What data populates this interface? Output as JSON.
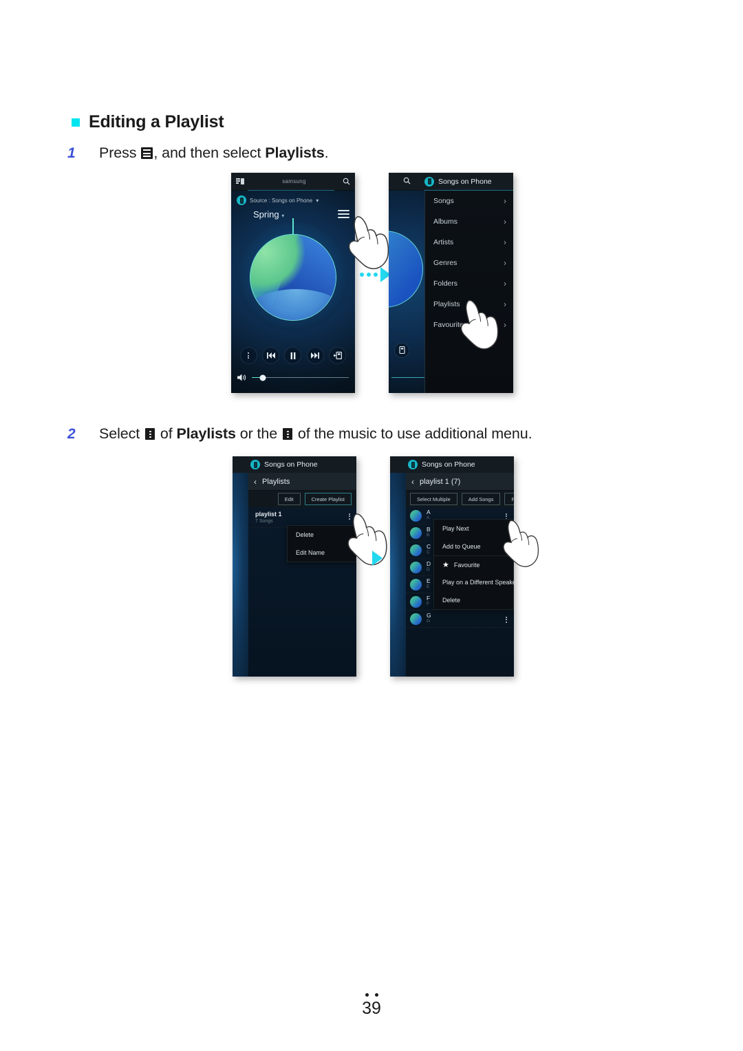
{
  "heading": {
    "bullet_color": "#00e5f0",
    "title": "Editing a Playlist"
  },
  "steps": [
    {
      "num": "1",
      "prefix": "Press ",
      "mid": ", and then select ",
      "bold": "Playlists",
      "suffix": "."
    },
    {
      "num": "2",
      "prefix": "Select ",
      "mid": " of ",
      "bold": "Playlists",
      "mid2": " or the ",
      "suffix": " of the music to use additional menu."
    }
  ],
  "phone1": {
    "topbar": {
      "cast_icon": "cast-icon",
      "title": "samsung",
      "search_icon": "search-icon"
    },
    "source_label": "Source : Songs on Phone",
    "source_caret": "▾",
    "song_title": "Spring",
    "song_caret": "▾",
    "menu_icon": "hamburger-menu-icon",
    "controls": [
      {
        "name": "more-options-button",
        "glyph": "⋮"
      },
      {
        "name": "previous-track-button",
        "glyph": "◄◄"
      },
      {
        "name": "pause-button",
        "glyph": "❚❚"
      },
      {
        "name": "next-track-button",
        "glyph": "►►"
      },
      {
        "name": "add-to-playlist-button",
        "glyph": "⊞"
      }
    ],
    "volume": {
      "icon": "speaker-icon",
      "level_percent": 11
    }
  },
  "phone2": {
    "search_icon": "search-icon",
    "title": "Songs on Phone",
    "list": [
      "Songs",
      "Albums",
      "Artists",
      "Genres",
      "Folders",
      "Playlists",
      "Favourites"
    ],
    "chevron": "›"
  },
  "phone3": {
    "title": "Songs on Phone",
    "back_icon": "back-chevron-icon",
    "subtitle": "Playlists",
    "buttons": [
      "Edit",
      "Create Playlist"
    ],
    "item": {
      "name": "playlist 1",
      "count": "7 Songs"
    },
    "context_menu": [
      "Delete",
      "Edit Name"
    ]
  },
  "phone4": {
    "title": "Songs on Phone",
    "back_icon": "back-chevron-icon",
    "subtitle": "playlist 1 (7)",
    "buttons": [
      "Select Multiple",
      "Add Songs",
      "Play All"
    ],
    "songs": [
      {
        "title": "A",
        "artist": "A"
      },
      {
        "title": "B",
        "artist": "B"
      },
      {
        "title": "C",
        "artist": "C"
      },
      {
        "title": "D",
        "artist": "D"
      },
      {
        "title": "E",
        "artist": "E"
      },
      {
        "title": "F",
        "artist": "F"
      },
      {
        "title": "G",
        "artist": "G"
      }
    ],
    "context_menu": [
      {
        "label": "Play Next",
        "icon": null
      },
      {
        "label": "Add to Queue",
        "icon": null
      },
      {
        "label": "Favourite",
        "icon": "star-icon"
      },
      {
        "label": "Play on a Different Speaker",
        "icon": null
      },
      {
        "label": "Delete",
        "icon": null
      }
    ]
  },
  "footer": {
    "page_number": "39"
  }
}
